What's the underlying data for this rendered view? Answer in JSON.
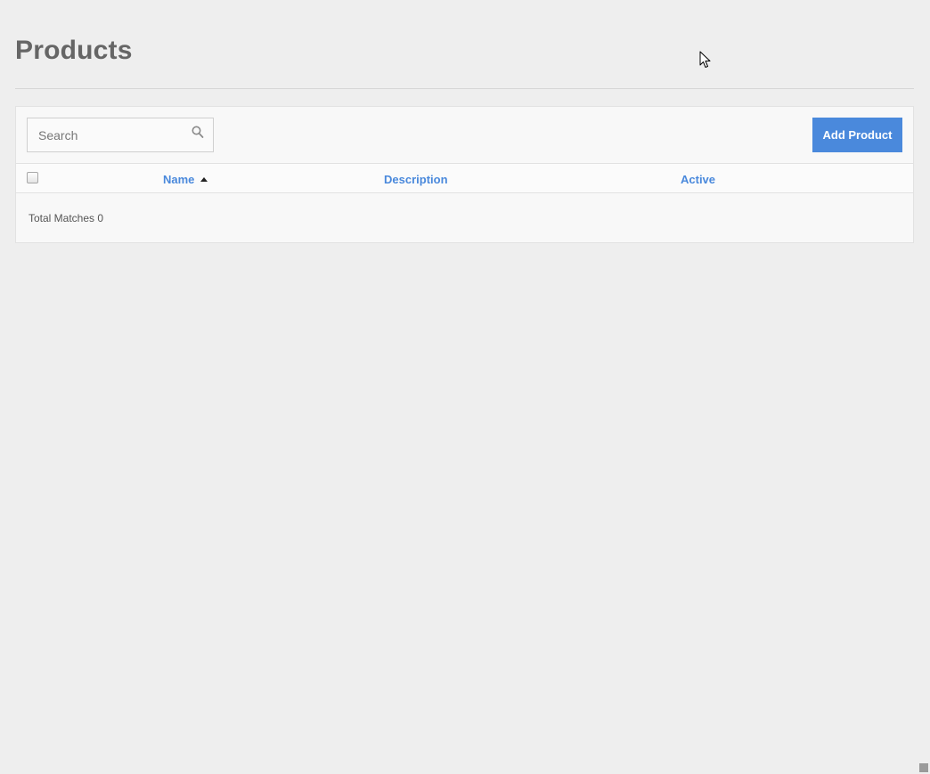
{
  "page": {
    "title": "Products"
  },
  "toolbar": {
    "search_placeholder": "Search",
    "add_label": "Add Product"
  },
  "table": {
    "columns": [
      "Name",
      "Description",
      "Active"
    ],
    "sort_column": "Name",
    "sort_direction": "ascending",
    "rows": []
  },
  "footer": {
    "total_matches": "Total Matches 0"
  },
  "icons": {
    "search": "search-icon",
    "sort": "sort-asc-icon",
    "cursor": "mouse-pointer-icon"
  },
  "colors": {
    "accent": "#4a89dc",
    "background": "#eeeeee",
    "panel": "#f8f8f8",
    "title": "#666666"
  }
}
